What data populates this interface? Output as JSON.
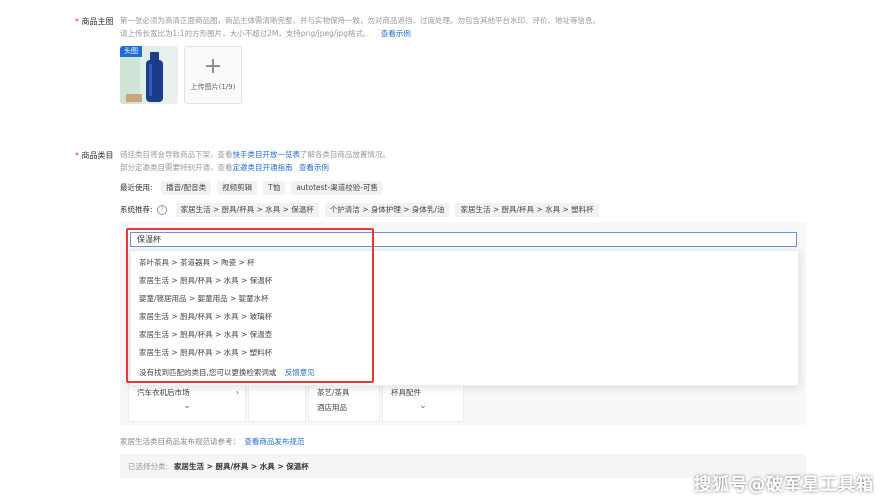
{
  "main_image": {
    "label": "商品主图",
    "required_mark": "*",
    "desc_line1": "第一张必须为高清正面商品图，商品主体需清晰完整、并与实物保持一致，勿对商品遮挡、过度处理。勿包含其他平台水印、评价、地址等信息。",
    "desc_line2": "请上传长宽比为1:1的方形图片，大小不超过2M，支持png/jpeg/jpg格式。",
    "example_link": "查看示例",
    "thumb_badge": "头图",
    "upload_label": "上传图片(1/9)"
  },
  "category": {
    "label": "商品类目",
    "required_mark": "*",
    "desc_line1_prefix": "错挂类目将会导致商品下架，查看",
    "desc_line1_link": "快手类目开放一览表",
    "desc_line1_suffix": "了解各类目商品放置情况。",
    "desc_line2_prefix": "部分定邀类目需要特别开通，查看",
    "desc_line2_link": "定邀类目开通指南",
    "desc_line2_example": "查看示例",
    "recent_label": "最近使用:",
    "recent_tags": [
      "播音/配音类",
      "视频剪辑",
      "T恤",
      "autotest-渠道校验-可售"
    ],
    "system_label": "系统推荐:",
    "system_tags": [
      "家居生活 > 厨具/杯具 > 水具 > 保温杯",
      "个护清洁 > 身体护理 > 身体乳/油",
      "家居生活 > 厨具/杯具 > 水具 > 塑料杯"
    ],
    "search_value": "保温杯",
    "results": [
      "茶叶茶具 > 茶道器具 > 陶瓷 > 杯",
      "家居生活 > 厨具/杯具 > 水具 > 保温杯",
      "婴童/寝居用品 > 婴童用品 > 婴童水杯",
      "家居生活 > 厨具/杯具 > 水具 > 玻璃杯",
      "家居生活 > 厨具/杯具 > 水具 > 保温壶",
      "家居生活 > 厨具/杯具 > 水具 > 塑料杯"
    ],
    "not_found": "没有找到匹配的类目,您可以更换检索词或",
    "feedback": "反馈意见",
    "col1_item": "汽车衣机后市场",
    "col3_items": [
      "茶艺/茶具",
      "酒店用品"
    ],
    "col4_item": "杯具配件",
    "norms_prefix": "家居生活类目商品发布规范请参考：",
    "norms_link": "查看商品发布规范",
    "selected_label": "已选择分类:",
    "selected_value": "家居生活 > 厨具/杯具 > 水具 > 保温杯"
  },
  "watermark": "搜狐号@破军星工具箱",
  "colors": {
    "link": "#1f6dd6",
    "required": "#e4393c",
    "highlight_box": "#e53935",
    "search_border": "#6d8fe8"
  }
}
